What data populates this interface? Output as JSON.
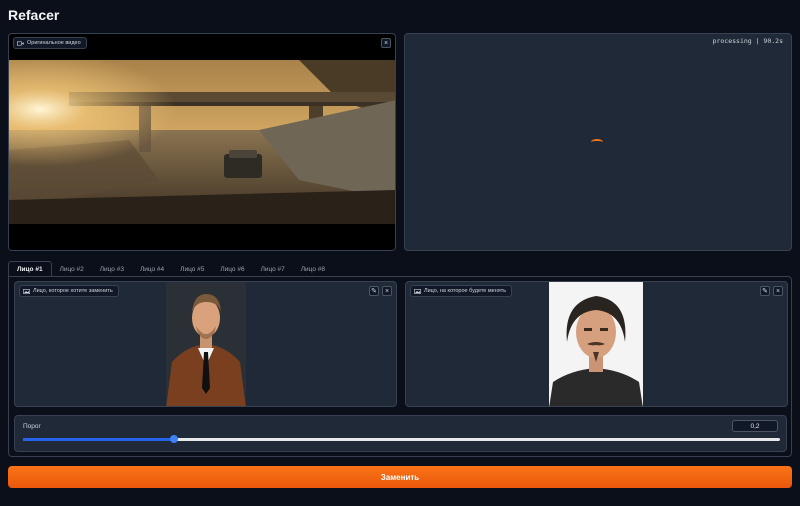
{
  "app": {
    "title": "Refacer"
  },
  "original_video": {
    "label": "Оригинальное видео",
    "close_icon": "×",
    "icon": "video-camera-icon"
  },
  "output_video": {
    "status": "processing | 90.2s"
  },
  "face_tabs": [
    {
      "label": "Лицо #1",
      "active": true
    },
    {
      "label": "Лицо #2"
    },
    {
      "label": "Лицо #3"
    },
    {
      "label": "Лицо #4"
    },
    {
      "label": "Лицо #5"
    },
    {
      "label": "Лицо #6"
    },
    {
      "label": "Лицо #7"
    },
    {
      "label": "Лицо #8"
    }
  ],
  "source_face": {
    "label": "Лицо, которое хотите заменить",
    "edit_icon": "✎",
    "close_icon": "×"
  },
  "target_face": {
    "label": "Лицо, на которое будете менять",
    "edit_icon": "✎",
    "close_icon": "×"
  },
  "threshold": {
    "label": "Порог",
    "value": "0,2",
    "fraction": 0.2
  },
  "submit": {
    "label": "Заменить"
  },
  "colors": {
    "accent": "#f97316",
    "background": "#0b0f19",
    "panel": "#1f2937",
    "slider": "#2563eb"
  }
}
